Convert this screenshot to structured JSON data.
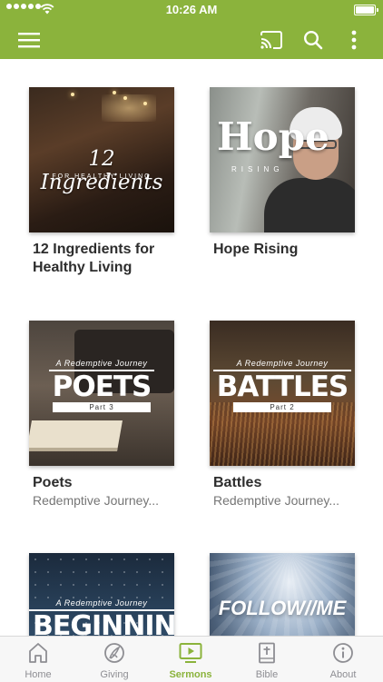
{
  "status_bar": {
    "time": "10:26 AM",
    "icons": [
      "signal-dots-icon",
      "wifi-icon",
      "battery-icon"
    ]
  },
  "app_bar": {
    "accent_color": "#8bb33c",
    "icons": [
      "menu-icon",
      "cast-icon",
      "search-icon",
      "more-vertical-icon"
    ]
  },
  "sermons": [
    {
      "title": "12 Ingredients for Healthy Living",
      "subtitle": "",
      "art_text": "12 Ingredients",
      "art_subtext": "FOR HEALTHY LIVING"
    },
    {
      "title": "Hope Rising",
      "subtitle": "",
      "art_text": "Hope",
      "art_subtext": "RISING"
    },
    {
      "title": "Poets",
      "subtitle": "Redemptive Journey...",
      "art_kicker": "A Redemptive Journey",
      "art_text": "POETS",
      "art_subtext": "Part 3"
    },
    {
      "title": "Battles",
      "subtitle": "Redemptive Journey...",
      "art_kicker": "A Redemptive Journey",
      "art_text": "BATTLES",
      "art_subtext": "Part 2"
    },
    {
      "title": "",
      "subtitle": "",
      "art_kicker": "A Redemptive Journey",
      "art_text": "BEGINNINGS"
    },
    {
      "title": "",
      "subtitle": "",
      "art_text": "FOLLOW//ME"
    }
  ],
  "tabs": [
    {
      "label": "Home",
      "icon": "home-icon",
      "active": false
    },
    {
      "label": "Giving",
      "icon": "giving-icon",
      "active": false
    },
    {
      "label": "Sermons",
      "icon": "tv-play-icon",
      "active": true
    },
    {
      "label": "Bible",
      "icon": "bible-icon",
      "active": false
    },
    {
      "label": "About",
      "icon": "info-icon",
      "active": false
    }
  ],
  "colors": {
    "active_tab": "#8bb33c",
    "inactive_tab": "#8e8e93"
  }
}
